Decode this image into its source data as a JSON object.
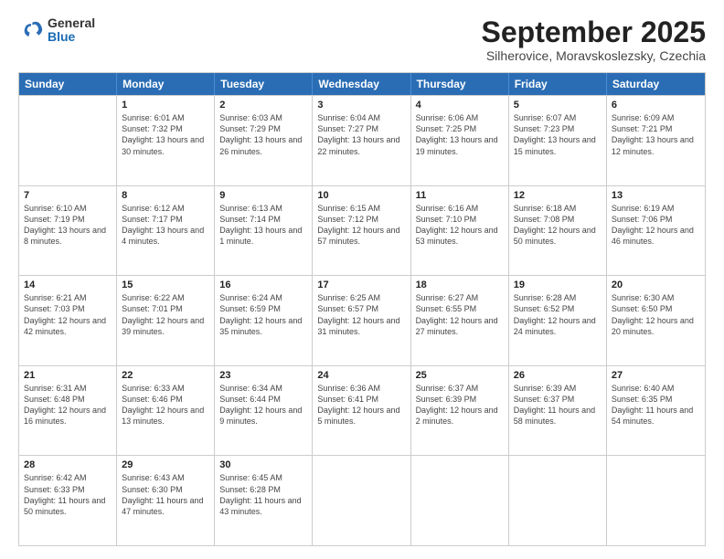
{
  "logo": {
    "general": "General",
    "blue": "Blue"
  },
  "header": {
    "month": "September 2025",
    "location": "Silherovice, Moravskoslezsky, Czechia"
  },
  "days_of_week": [
    "Sunday",
    "Monday",
    "Tuesday",
    "Wednesday",
    "Thursday",
    "Friday",
    "Saturday"
  ],
  "weeks": [
    [
      {
        "day": "",
        "sunrise": "",
        "sunset": "",
        "daylight": ""
      },
      {
        "day": "1",
        "sunrise": "Sunrise: 6:01 AM",
        "sunset": "Sunset: 7:32 PM",
        "daylight": "Daylight: 13 hours and 30 minutes."
      },
      {
        "day": "2",
        "sunrise": "Sunrise: 6:03 AM",
        "sunset": "Sunset: 7:29 PM",
        "daylight": "Daylight: 13 hours and 26 minutes."
      },
      {
        "day": "3",
        "sunrise": "Sunrise: 6:04 AM",
        "sunset": "Sunset: 7:27 PM",
        "daylight": "Daylight: 13 hours and 22 minutes."
      },
      {
        "day": "4",
        "sunrise": "Sunrise: 6:06 AM",
        "sunset": "Sunset: 7:25 PM",
        "daylight": "Daylight: 13 hours and 19 minutes."
      },
      {
        "day": "5",
        "sunrise": "Sunrise: 6:07 AM",
        "sunset": "Sunset: 7:23 PM",
        "daylight": "Daylight: 13 hours and 15 minutes."
      },
      {
        "day": "6",
        "sunrise": "Sunrise: 6:09 AM",
        "sunset": "Sunset: 7:21 PM",
        "daylight": "Daylight: 13 hours and 12 minutes."
      }
    ],
    [
      {
        "day": "7",
        "sunrise": "Sunrise: 6:10 AM",
        "sunset": "Sunset: 7:19 PM",
        "daylight": "Daylight: 13 hours and 8 minutes."
      },
      {
        "day": "8",
        "sunrise": "Sunrise: 6:12 AM",
        "sunset": "Sunset: 7:17 PM",
        "daylight": "Daylight: 13 hours and 4 minutes."
      },
      {
        "day": "9",
        "sunrise": "Sunrise: 6:13 AM",
        "sunset": "Sunset: 7:14 PM",
        "daylight": "Daylight: 13 hours and 1 minute."
      },
      {
        "day": "10",
        "sunrise": "Sunrise: 6:15 AM",
        "sunset": "Sunset: 7:12 PM",
        "daylight": "Daylight: 12 hours and 57 minutes."
      },
      {
        "day": "11",
        "sunrise": "Sunrise: 6:16 AM",
        "sunset": "Sunset: 7:10 PM",
        "daylight": "Daylight: 12 hours and 53 minutes."
      },
      {
        "day": "12",
        "sunrise": "Sunrise: 6:18 AM",
        "sunset": "Sunset: 7:08 PM",
        "daylight": "Daylight: 12 hours and 50 minutes."
      },
      {
        "day": "13",
        "sunrise": "Sunrise: 6:19 AM",
        "sunset": "Sunset: 7:06 PM",
        "daylight": "Daylight: 12 hours and 46 minutes."
      }
    ],
    [
      {
        "day": "14",
        "sunrise": "Sunrise: 6:21 AM",
        "sunset": "Sunset: 7:03 PM",
        "daylight": "Daylight: 12 hours and 42 minutes."
      },
      {
        "day": "15",
        "sunrise": "Sunrise: 6:22 AM",
        "sunset": "Sunset: 7:01 PM",
        "daylight": "Daylight: 12 hours and 39 minutes."
      },
      {
        "day": "16",
        "sunrise": "Sunrise: 6:24 AM",
        "sunset": "Sunset: 6:59 PM",
        "daylight": "Daylight: 12 hours and 35 minutes."
      },
      {
        "day": "17",
        "sunrise": "Sunrise: 6:25 AM",
        "sunset": "Sunset: 6:57 PM",
        "daylight": "Daylight: 12 hours and 31 minutes."
      },
      {
        "day": "18",
        "sunrise": "Sunrise: 6:27 AM",
        "sunset": "Sunset: 6:55 PM",
        "daylight": "Daylight: 12 hours and 27 minutes."
      },
      {
        "day": "19",
        "sunrise": "Sunrise: 6:28 AM",
        "sunset": "Sunset: 6:52 PM",
        "daylight": "Daylight: 12 hours and 24 minutes."
      },
      {
        "day": "20",
        "sunrise": "Sunrise: 6:30 AM",
        "sunset": "Sunset: 6:50 PM",
        "daylight": "Daylight: 12 hours and 20 minutes."
      }
    ],
    [
      {
        "day": "21",
        "sunrise": "Sunrise: 6:31 AM",
        "sunset": "Sunset: 6:48 PM",
        "daylight": "Daylight: 12 hours and 16 minutes."
      },
      {
        "day": "22",
        "sunrise": "Sunrise: 6:33 AM",
        "sunset": "Sunset: 6:46 PM",
        "daylight": "Daylight: 12 hours and 13 minutes."
      },
      {
        "day": "23",
        "sunrise": "Sunrise: 6:34 AM",
        "sunset": "Sunset: 6:44 PM",
        "daylight": "Daylight: 12 hours and 9 minutes."
      },
      {
        "day": "24",
        "sunrise": "Sunrise: 6:36 AM",
        "sunset": "Sunset: 6:41 PM",
        "daylight": "Daylight: 12 hours and 5 minutes."
      },
      {
        "day": "25",
        "sunrise": "Sunrise: 6:37 AM",
        "sunset": "Sunset: 6:39 PM",
        "daylight": "Daylight: 12 hours and 2 minutes."
      },
      {
        "day": "26",
        "sunrise": "Sunrise: 6:39 AM",
        "sunset": "Sunset: 6:37 PM",
        "daylight": "Daylight: 11 hours and 58 minutes."
      },
      {
        "day": "27",
        "sunrise": "Sunrise: 6:40 AM",
        "sunset": "Sunset: 6:35 PM",
        "daylight": "Daylight: 11 hours and 54 minutes."
      }
    ],
    [
      {
        "day": "28",
        "sunrise": "Sunrise: 6:42 AM",
        "sunset": "Sunset: 6:33 PM",
        "daylight": "Daylight: 11 hours and 50 minutes."
      },
      {
        "day": "29",
        "sunrise": "Sunrise: 6:43 AM",
        "sunset": "Sunset: 6:30 PM",
        "daylight": "Daylight: 11 hours and 47 minutes."
      },
      {
        "day": "30",
        "sunrise": "Sunrise: 6:45 AM",
        "sunset": "Sunset: 6:28 PM",
        "daylight": "Daylight: 11 hours and 43 minutes."
      },
      {
        "day": "",
        "sunrise": "",
        "sunset": "",
        "daylight": ""
      },
      {
        "day": "",
        "sunrise": "",
        "sunset": "",
        "daylight": ""
      },
      {
        "day": "",
        "sunrise": "",
        "sunset": "",
        "daylight": ""
      },
      {
        "day": "",
        "sunrise": "",
        "sunset": "",
        "daylight": ""
      }
    ]
  ]
}
